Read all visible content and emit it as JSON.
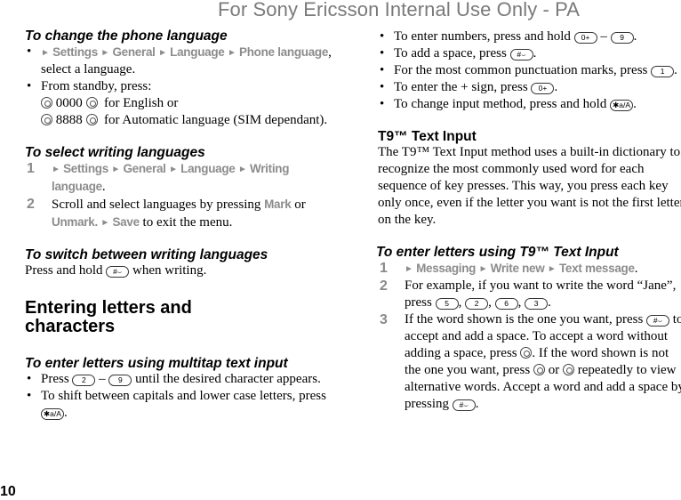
{
  "watermark": "For Sony Ericsson Internal Use Only - PA",
  "page_number": "10",
  "left": {
    "change_lang": {
      "title": "To change the phone language",
      "b1_menu": [
        "Settings",
        "General",
        "Language",
        "Phone language"
      ],
      "b1_rest": ", select a language.",
      "b2_line1": "From standby, press:",
      "b2_line2_code": "0000",
      "b2_line2_rest": "for English or",
      "b2_line3_code": "8888",
      "b2_line3_rest": "for Automatic language (SIM dependant)."
    },
    "select_writing": {
      "title": "To select writing languages",
      "s1_num": "1",
      "s1_menu": [
        "Settings",
        "General",
        "Language",
        "Writing language"
      ],
      "s1_rest": ".",
      "s2_num": "2",
      "s2_text1": "Scroll and select languages by pressing ",
      "s2_mark": "Mark",
      "s2_text2": " or ",
      "s2_unmark": "Unmark",
      "s2_save": "Save",
      "s2_text3": " to exit the menu."
    },
    "switch_writing": {
      "title": "To switch between writing languages",
      "text1": "Press and hold ",
      "key": "#⌣",
      "text2": " when writing."
    },
    "entering": {
      "title": "Entering letters and characters"
    },
    "multitap": {
      "title": "To enter letters using multitap text input",
      "b1_text1": "Press ",
      "b1_key1": "2",
      "b1_dash": " – ",
      "b1_key2": "9",
      "b1_text2": " until the desired character appears.",
      "b2_text1": "To shift between capitals and lower case letters, press ",
      "b2_key": "✱a/A",
      "b2_text2": "."
    }
  },
  "right": {
    "bullets": [
      {
        "text1": "To enter numbers, press and hold ",
        "key1": "0+",
        "dash": " – ",
        "key2": "9",
        "text2": "."
      },
      {
        "text1": "To add a space, press ",
        "key1": "#⌣",
        "text2": "."
      },
      {
        "text1": "For the most common punctuation marks, press ",
        "key1": "1",
        "text2": "."
      },
      {
        "text1": "To enter the + sign, press ",
        "key1": "0+",
        "text2": "."
      },
      {
        "text1": "To change input method, press and hold ",
        "key1": "✱a/A",
        "text2": "."
      }
    ],
    "t9": {
      "title": "T9™ Text Input",
      "body": "The T9™ Text Input method uses a built-in dictionary to recognize the most commonly used word for each sequence of key presses. This way, you press each key only once, even if the letter you want is not the first letter on the key."
    },
    "t9_enter": {
      "title": "To enter letters using T9™ Text Input",
      "s1_num": "1",
      "s1_menu": [
        "Messaging",
        "Write new",
        "Text message"
      ],
      "s1_rest": ".",
      "s2_num": "2",
      "s2_text1": "For example, if you want to write the word “Jane”, press ",
      "s2_keys": [
        "5",
        "2",
        "6",
        "3"
      ],
      "s2_text2": ".",
      "s3_num": "3",
      "s3_text1": "If the word shown is the one you want, press ",
      "s3_key1": "#⌣",
      "s3_text2": " to accept and add a space. To accept a word without adding a space, press ",
      "s3_text3": ". If the word shown is not the one you want, press ",
      "s3_text4": " or ",
      "s3_text5": " repeatedly to view alternative words. Accept a word and add a space by pressing ",
      "s3_key2": "#⌣",
      "s3_text6": "."
    }
  }
}
